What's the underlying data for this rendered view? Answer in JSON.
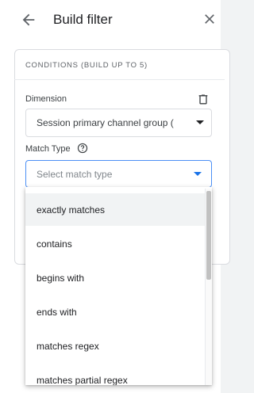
{
  "header": {
    "title": "Build filter"
  },
  "conditions": {
    "title": "CONDITIONS (BUILD UP TO 5)",
    "dimension_label": "Dimension",
    "dimension_value": "Session primary channel group (",
    "match_type_label": "Match Type",
    "match_placeholder": "Select match type"
  },
  "dropdown": {
    "options": [
      "exactly matches",
      "contains",
      "begins with",
      "ends with",
      "matches regex",
      "matches partial regex"
    ]
  },
  "colors": {
    "accent": "#1a73e8",
    "focus_border": "#4b8ff5",
    "highlight": "#f1f3f4"
  }
}
